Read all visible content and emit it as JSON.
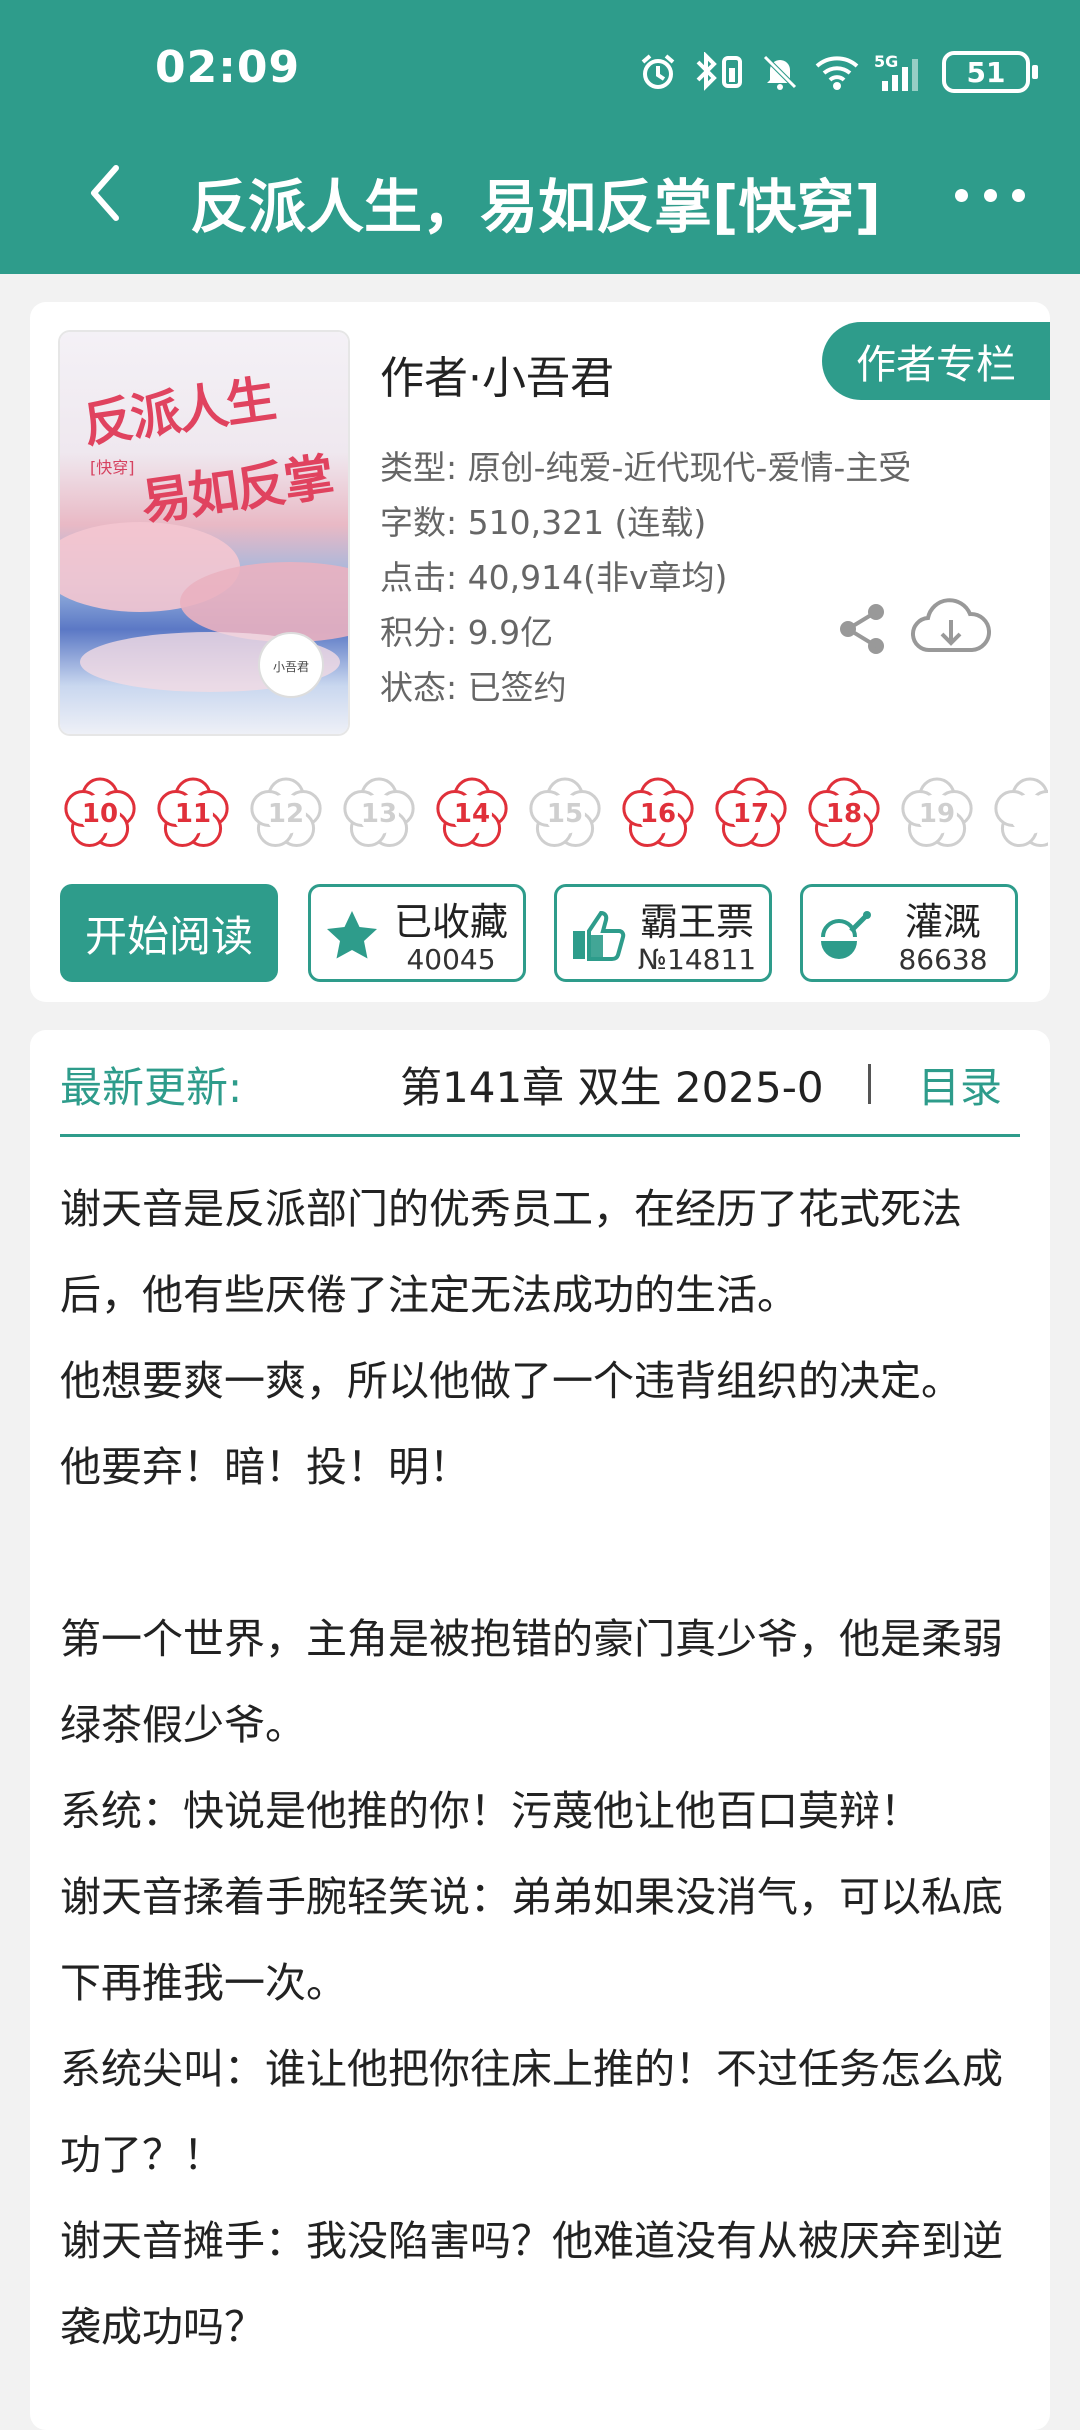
{
  "status_bar": {
    "time": "02:09",
    "battery": "51",
    "icons": [
      "alarm-icon",
      "bluetooth-icon",
      "mute-icon",
      "wifi-icon",
      "signal-5g-icon"
    ]
  },
  "header": {
    "title": "反派人生，易如反掌[快穿]",
    "back_icon": "back-arrow-icon",
    "more_icon": "more-dots-icon"
  },
  "book": {
    "cover": {
      "line1": "反派人生",
      "line2": "易如反掌",
      "tag": "[快穿]",
      "author_seal": "小吾君"
    },
    "author": "作者·小吾君",
    "author_column_button": "作者专栏",
    "meta": [
      "类型: 原创-纯爱-近代现代-爱情-主受",
      "字数: 510,321 (连载)",
      "点击: 40,914(非v章均)",
      "积分: 9.9亿",
      "状态: 已签约"
    ],
    "flowers": [
      {
        "num": "10",
        "active": true
      },
      {
        "num": "11",
        "active": true
      },
      {
        "num": "12",
        "active": false
      },
      {
        "num": "13",
        "active": false
      },
      {
        "num": "14",
        "active": true
      },
      {
        "num": "15",
        "active": false
      },
      {
        "num": "16",
        "active": true
      },
      {
        "num": "17",
        "active": true
      },
      {
        "num": "18",
        "active": true
      },
      {
        "num": "19",
        "active": false
      },
      {
        "num": "",
        "active": false
      }
    ],
    "read_button": "开始阅读",
    "stats": [
      {
        "label": "已收藏",
        "count": "40045",
        "icon": "star-icon"
      },
      {
        "label": "霸王票",
        "count": "№14811",
        "icon": "thumbs-up-icon"
      },
      {
        "label": "灌溉",
        "count": "86638",
        "icon": "watering-icon"
      }
    ]
  },
  "update": {
    "label": "最新更新:",
    "text": "第141章  双生  2025-0",
    "toc": "目录"
  },
  "intro": [
    "谢天音是反派部门的优秀员工，在经历了花式死法后，他有些厌倦了注定无法成功的生活。",
    "他想要爽一爽，所以他做了一个违背组织的决定。",
    "他要弃！暗！投！明！",
    " ",
    "第一个世界，主角是被抱错的豪门真少爷，他是柔弱绿茶假少爷。",
    "系统：快说是他推的你！污蔑他让他百口莫辩！",
    "谢天音揉着手腕轻笑说：弟弟如果没消气，可以私底下再推我一次。",
    "系统尖叫：谁让他把你往床上推的！不过任务怎么成功了？！",
    "谢天音摊手：我没陷害吗？他难道没有从被厌弃到逆袭成功吗？"
  ],
  "colors": {
    "brand": "#2e9c8b",
    "flower_active": "#e0303a",
    "flower_inactive": "#cfcfcf"
  }
}
